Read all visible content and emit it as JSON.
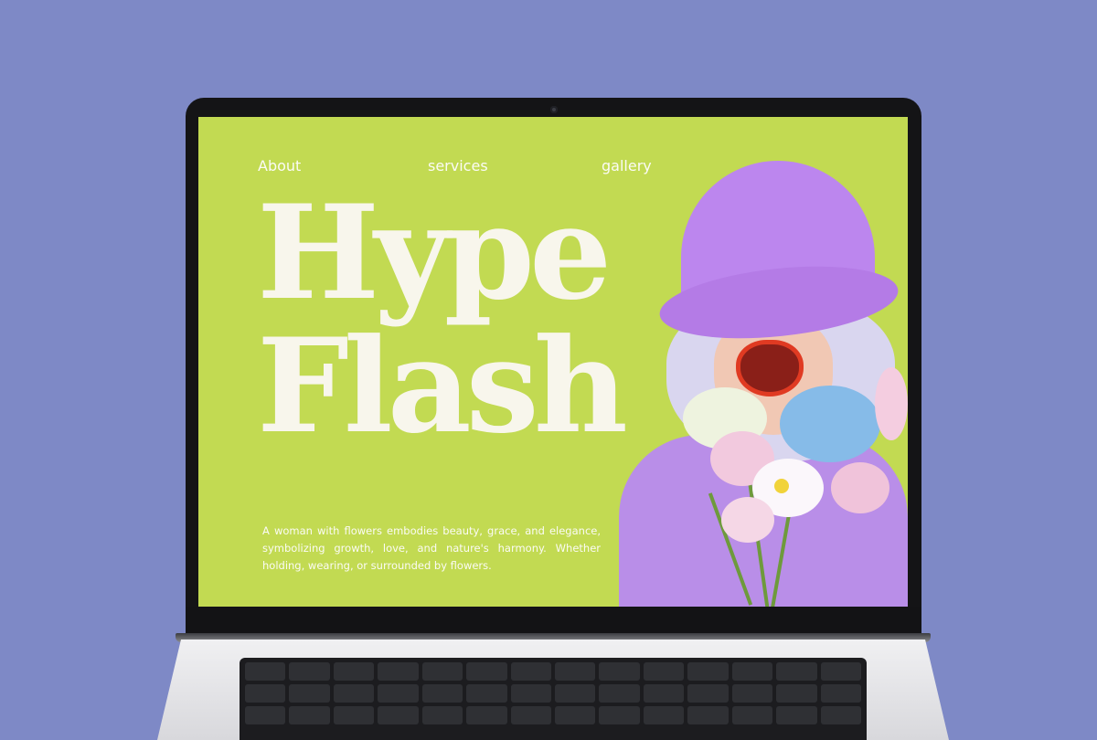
{
  "nav": {
    "about": "About",
    "services": "services",
    "gallery": "gallery"
  },
  "hero": {
    "title_line1": "Hype",
    "title_line2": "Flash",
    "description": "A woman with flowers embodies beauty, grace, and elegance, symbolizing growth, love, and nature's harmony. Whether holding, wearing, or surrounded by flowers."
  },
  "colors": {
    "page_background": "#7e89c6",
    "screen_background": "#c2da52",
    "text": "#f8f6ec",
    "hat": "#bc86ee"
  }
}
